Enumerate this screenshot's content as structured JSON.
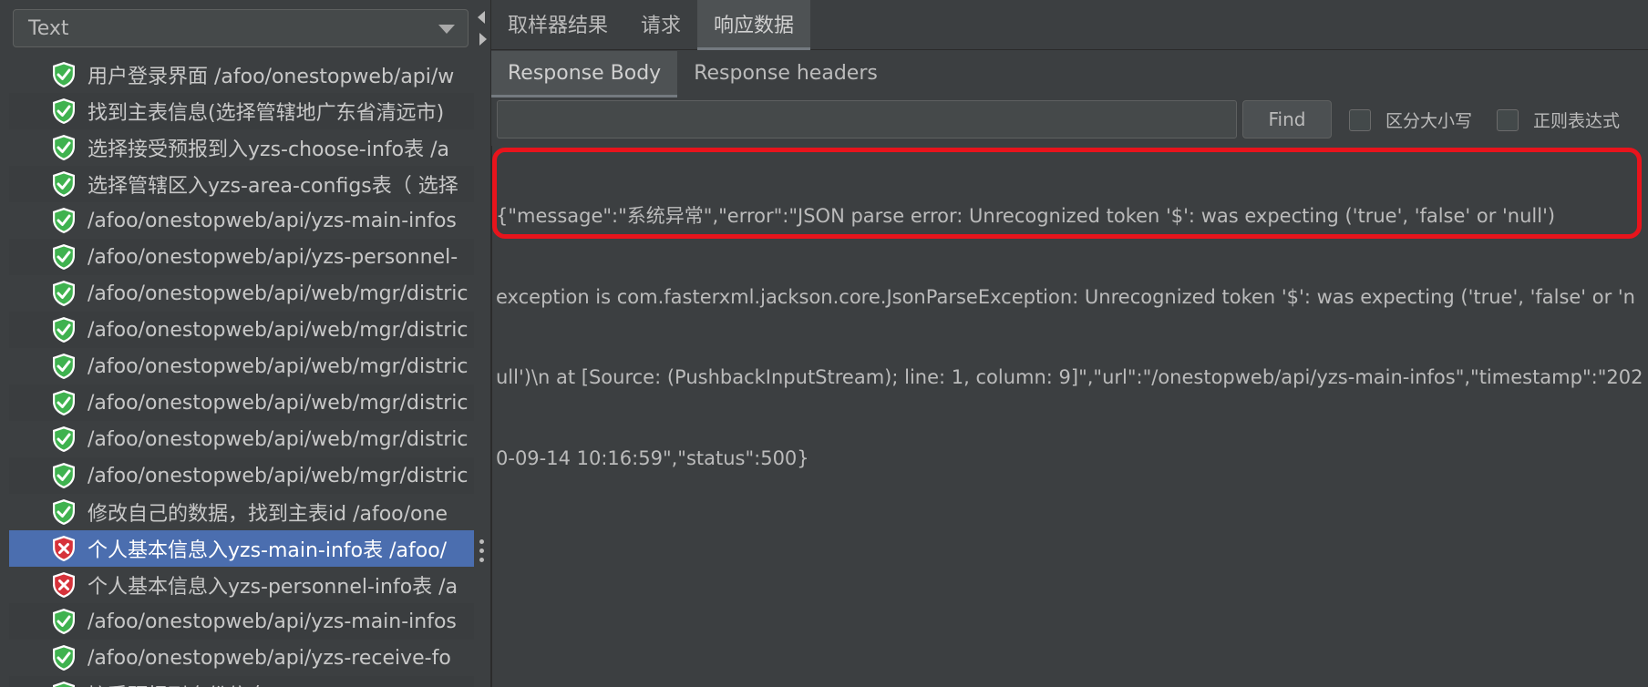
{
  "renderer": {
    "selected": "Text"
  },
  "tree": {
    "items": [
      {
        "label": "用户登录界面  /afoo/onestopweb/api/w",
        "status": "ok"
      },
      {
        "label": "找到主表信息(选择管辖地广东省清远市)",
        "status": "ok"
      },
      {
        "label": "选择接受预报到入yzs-choose-info表  /a",
        "status": "ok"
      },
      {
        "label": "选择管辖区入yzs-area-configs表（ 选择",
        "status": "ok"
      },
      {
        "label": "/afoo/onestopweb/api/yzs-main-infos",
        "status": "ok"
      },
      {
        "label": "/afoo/onestopweb/api/yzs-personnel-",
        "status": "ok"
      },
      {
        "label": "/afoo/onestopweb/api/web/mgr/distric",
        "status": "ok"
      },
      {
        "label": "/afoo/onestopweb/api/web/mgr/distric",
        "status": "ok"
      },
      {
        "label": "/afoo/onestopweb/api/web/mgr/distric",
        "status": "ok"
      },
      {
        "label": "/afoo/onestopweb/api/web/mgr/distric",
        "status": "ok"
      },
      {
        "label": "/afoo/onestopweb/api/web/mgr/distric",
        "status": "ok"
      },
      {
        "label": "/afoo/onestopweb/api/web/mgr/distric",
        "status": "ok"
      },
      {
        "label": "修改自己的数据，找到主表id  /afoo/one",
        "status": "ok"
      },
      {
        "label": "个人基本信息入yzs-main-info表 /afoo/",
        "status": "error",
        "selected": true
      },
      {
        "label": "个人基本信息入yzs-personnel-info表 /a",
        "status": "error"
      },
      {
        "label": "/afoo/onestopweb/api/yzs-main-infos",
        "status": "ok"
      },
      {
        "label": "/afoo/onestopweb/api/yzs-receive-fo",
        "status": "ok"
      },
      {
        "label": "接受预报到身份信息 /afoo/onestopweb",
        "status": "ok"
      }
    ]
  },
  "tabs": {
    "top": [
      "取样器结果",
      "请求",
      "响应数据"
    ],
    "top_active": 2,
    "sub": [
      "Response Body",
      "Response headers"
    ],
    "sub_active": 0
  },
  "search": {
    "value": "",
    "find_label": "Find",
    "case_label": "区分大小写",
    "regex_label": "正则表达式"
  },
  "response": {
    "lines": [
      "{\"message\":\"系统异常\",\"error\":\"JSON parse error: Unrecognized token '$': was expecting ('true', 'false' or 'null')",
      "exception is com.fasterxml.jackson.core.JsonParseException: Unrecognized token '$': was expecting ('true', 'false' or 'n",
      "ull')\\n at [Source: (PushbackInputStream); line: 1, column: 9]\",\"url\":\"/onestopweb/api/yzs-main-infos\",\"timestamp\":\"202",
      "0-09-14 10:16:59\",\"status\":500}"
    ]
  },
  "colors": {
    "ok_shield": "#3fb24f",
    "error_shield": "#d6323a",
    "highlight": "#e8141c",
    "selected_row": "#4b6eaf"
  }
}
